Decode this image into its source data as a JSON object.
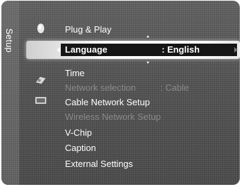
{
  "setup_tab": {
    "label": "Setup"
  },
  "icons": [
    {
      "name": "picture-icon"
    },
    {
      "name": "settings-gear-icon"
    },
    {
      "name": "channel-icon"
    },
    {
      "name": "input-icon"
    }
  ],
  "menu": {
    "items": [
      {
        "label": "Plug & Play",
        "value": "",
        "state": "normal"
      },
      {
        "label": "Language",
        "value": ": English",
        "state": "selected"
      },
      {
        "label": "Time",
        "value": "",
        "state": "normal"
      },
      {
        "label": "Network selection",
        "value": ": Cable",
        "state": "disabled"
      },
      {
        "label": "Cable Network Setup",
        "value": "",
        "state": "normal"
      },
      {
        "label": "Wireless Network Setup",
        "value": "",
        "state": "disabled"
      },
      {
        "label": "V-Chip",
        "value": "",
        "state": "normal"
      },
      {
        "label": "Caption",
        "value": "",
        "state": "normal"
      },
      {
        "label": "External Settings",
        "value": "",
        "state": "normal"
      }
    ]
  },
  "colors": {
    "panel_bg": "#4c4c4c",
    "text": "#ffffff",
    "disabled_text": "#8a8a8a",
    "highlight_bar": "#151515"
  }
}
